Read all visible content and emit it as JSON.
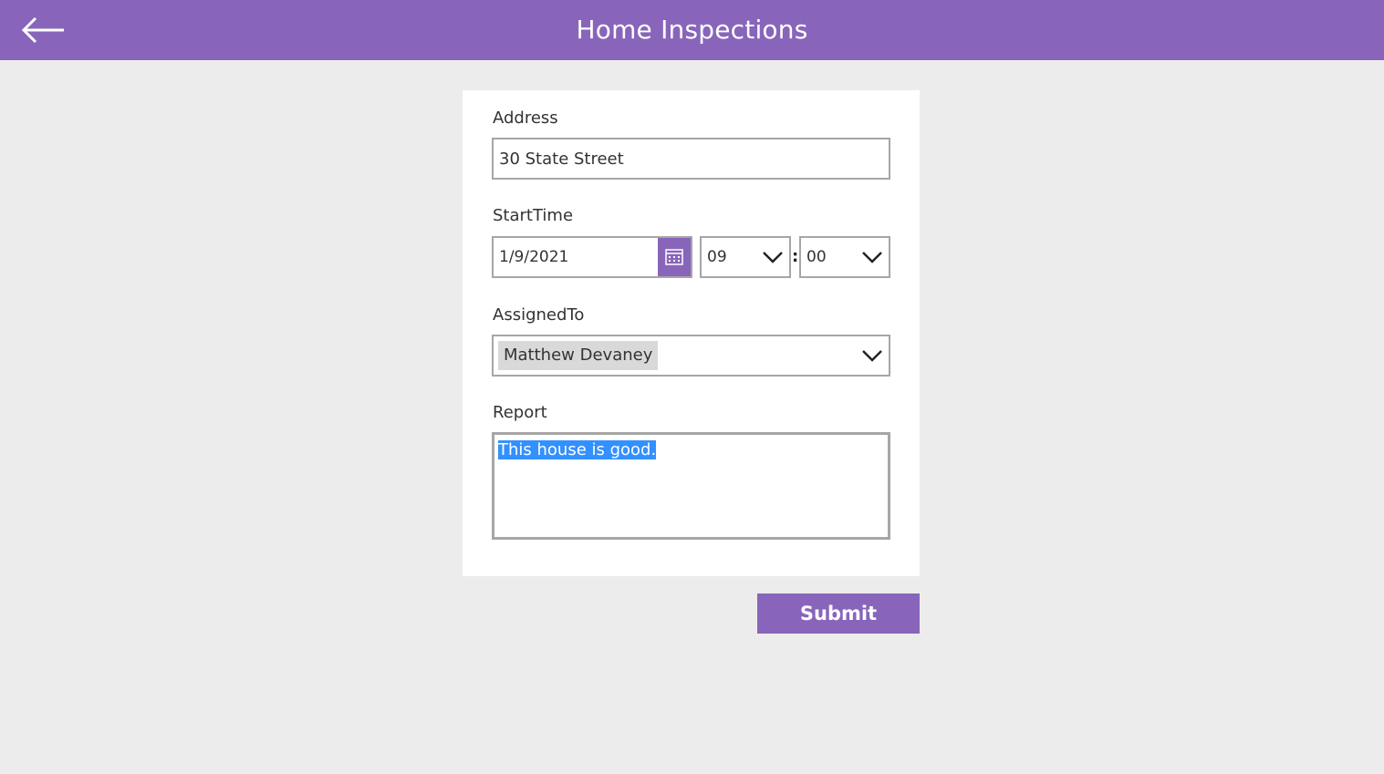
{
  "header": {
    "title": "Home Inspections",
    "back_icon": "arrow-left-icon"
  },
  "form": {
    "address": {
      "label": "Address",
      "value": "30 State Street"
    },
    "start_time": {
      "label": "StartTime",
      "date": "1/9/2021",
      "calendar_icon": "calendar-icon",
      "hour": "09",
      "separator": ":",
      "minute": "00"
    },
    "assigned_to": {
      "label": "AssignedTo",
      "value": "Matthew Devaney"
    },
    "report": {
      "label": "Report",
      "value": "This house is good."
    }
  },
  "actions": {
    "submit_label": "Submit"
  },
  "colors": {
    "accent": "#8865BA",
    "background": "#EDECEC",
    "selection": "#3390FF"
  }
}
